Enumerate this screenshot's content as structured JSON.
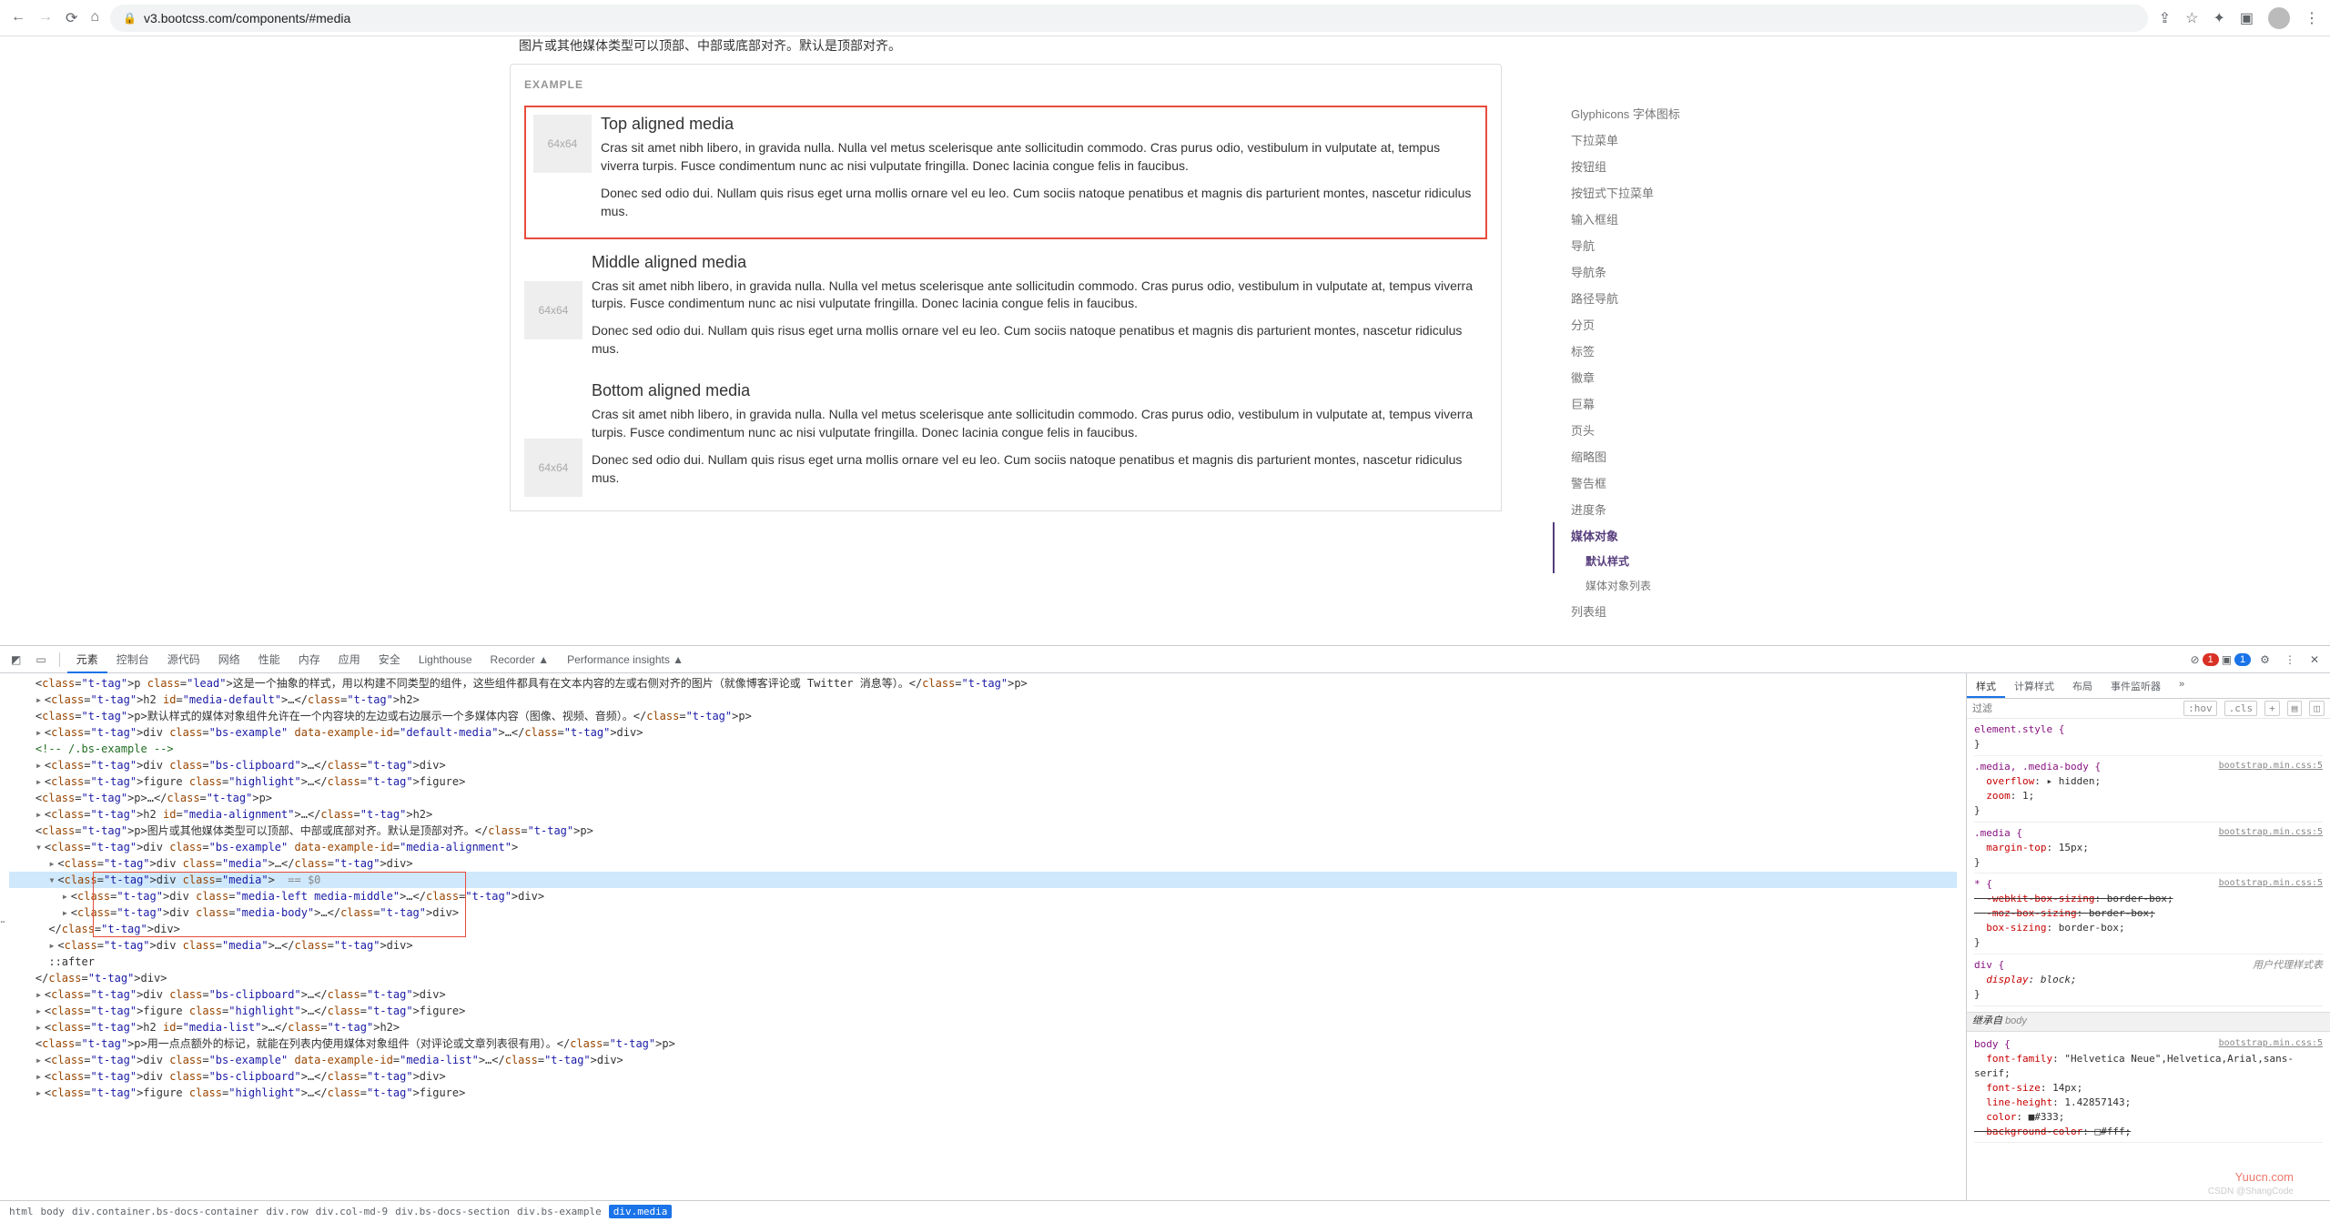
{
  "browser": {
    "url": "v3.bootcss.com/components/#media",
    "icons": {
      "back": "←",
      "forward": "→",
      "reload": "⟳",
      "home": "⌂",
      "lock": "🔒",
      "share": "⇪",
      "star": "☆",
      "ext": "✦",
      "profile": "▣",
      "menu": "⋮"
    }
  },
  "page": {
    "truncated_text": "图片或其他媒体类型可以顶部、中部或底部对齐。默认是顶部对齐。",
    "example_label": "EXAMPLE",
    "placeholder": "64x64",
    "para1": "Cras sit amet nibh libero, in gravida nulla. Nulla vel metus scelerisque ante sollicitudin commodo. Cras purus odio, vestibulum in vulputate at, tempus viverra turpis. Fusce condimentum nunc ac nisi vulputate fringilla. Donec lacinia congue felis in faucibus.",
    "para2": "Donec sed odio dui. Nullam quis risus eget urna mollis ornare vel eu leo. Cum sociis natoque penatibus et magnis dis parturient montes, nascetur ridiculus mus.",
    "headings": {
      "top": "Top aligned media",
      "middle": "Middle aligned media",
      "bottom": "Bottom aligned media"
    }
  },
  "sidebar": {
    "items": [
      {
        "label": "Glyphicons 字体图标"
      },
      {
        "label": "下拉菜单"
      },
      {
        "label": "按钮组"
      },
      {
        "label": "按钮式下拉菜单"
      },
      {
        "label": "输入框组"
      },
      {
        "label": "导航"
      },
      {
        "label": "导航条"
      },
      {
        "label": "路径导航"
      },
      {
        "label": "分页"
      },
      {
        "label": "标签"
      },
      {
        "label": "徽章"
      },
      {
        "label": "巨幕"
      },
      {
        "label": "页头"
      },
      {
        "label": "缩略图"
      },
      {
        "label": "警告框"
      },
      {
        "label": "进度条"
      },
      {
        "label": "媒体对象",
        "active": true,
        "sub": [
          {
            "label": "默认样式",
            "active": true
          },
          {
            "label": "媒体对象列表"
          }
        ]
      },
      {
        "label": "列表组"
      }
    ]
  },
  "devtools": {
    "tabs": [
      "元素",
      "控制台",
      "源代码",
      "网络",
      "性能",
      "内存",
      "应用",
      "安全",
      "Lighthouse",
      "Recorder ▲",
      "Performance insights ▲"
    ],
    "active_tab": "元素",
    "err_count": "1",
    "info_count": "1",
    "settings": "⚙",
    "more": "⋮",
    "close": "✕",
    "lines": [
      {
        "i": 2,
        "h": "<p class=\"lead\">这是一个抽象的样式，用以构建不同类型的组件，这些组件都具有在文本内容的左或右侧对齐的图片（就像博客评论或 Twitter 消息等）。</p>"
      },
      {
        "i": 2,
        "a": "▸",
        "h": "<h2 id=\"media-default\">…</h2>"
      },
      {
        "i": 2,
        "h": "<p>默认样式的媒体对象组件允许在一个内容块的左边或右边展示一个多媒体内容（图像、视频、音频）。</p>"
      },
      {
        "i": 2,
        "a": "▸",
        "h": "<div class=\"bs-example\" data-example-id=\"default-media\">…</div>"
      },
      {
        "i": 2,
        "cmt": "<!-- /.bs-example -->"
      },
      {
        "i": 2,
        "a": "▸",
        "h": "<div class=\"bs-clipboard\">…</div>"
      },
      {
        "i": 2,
        "a": "▸",
        "h": "<figure class=\"highlight\">…</figure>"
      },
      {
        "i": 2,
        "h": "<p>…</p>"
      },
      {
        "i": 2,
        "a": "▸",
        "h": "<h2 id=\"media-alignment\">…</h2>"
      },
      {
        "i": 2,
        "h": "<p>图片或其他媒体类型可以顶部、中部或底部对齐。默认是顶部对齐。</p>"
      },
      {
        "i": 2,
        "a": "▾",
        "h": "<div class=\"bs-example\" data-example-id=\"media-alignment\">"
      },
      {
        "i": 3,
        "a": "▸",
        "h": "<div class=\"media\">…</div>"
      },
      {
        "i": 3,
        "a": "▾",
        "h": "<div class=\"media\"> == $0",
        "hl": true
      },
      {
        "i": 4,
        "a": "▸",
        "h": "<div class=\"media-left media-middle\">…</div>"
      },
      {
        "i": 4,
        "a": "▸",
        "h": "<div class=\"media-body\">…</div>"
      },
      {
        "i": 3,
        "h": "</div>"
      },
      {
        "i": 3,
        "a": "▸",
        "h": "<div class=\"media\">…</div>"
      },
      {
        "i": 3,
        "h": "::after"
      },
      {
        "i": 2,
        "h": "</div>"
      },
      {
        "i": 2,
        "a": "▸",
        "h": "<div class=\"bs-clipboard\">…</div>"
      },
      {
        "i": 2,
        "a": "▸",
        "h": "<figure class=\"highlight\">…</figure>"
      },
      {
        "i": 2,
        "a": "▸",
        "h": "<h2 id=\"media-list\">…</h2>"
      },
      {
        "i": 2,
        "h": "<p>用一点点额外的标记，就能在列表内使用媒体对象组件（对评论或文章列表很有用）。</p>"
      },
      {
        "i": 2,
        "a": "▸",
        "h": "<div class=\"bs-example\" data-example-id=\"media-list\">…</div>"
      },
      {
        "i": 2,
        "a": "▸",
        "h": "<div class=\"bs-clipboard\">…</div>"
      },
      {
        "i": 2,
        "a": "▸",
        "h": "<figure class=\"highlight\">…</figure>"
      }
    ],
    "crumbs": [
      "html",
      "body",
      "div.container.bs-docs-container",
      "div.row",
      "div.col-md-9",
      "div.bs-docs-section",
      "div.bs-example",
      "div.media"
    ],
    "styles": {
      "tabs": [
        "样式",
        "计算样式",
        "布局",
        "事件监听器",
        "»"
      ],
      "filter_ph": "过滤",
      "hov": ":hov",
      "cls": ".cls",
      "rules": [
        {
          "sel": "element.style {",
          "props": [],
          "end": "}"
        },
        {
          "sel": ".media, .media-body {",
          "src": "bootstrap.min.css:5",
          "props": [
            {
              "p": "overflow",
              "v": "▸ hidden;"
            },
            {
              "p": "zoom",
              "v": "1;"
            }
          ],
          "end": "}"
        },
        {
          "sel": ".media {",
          "src": "bootstrap.min.css:5",
          "props": [
            {
              "p": "margin-top",
              "v": "15px;"
            }
          ],
          "end": "}"
        },
        {
          "sel": "* {",
          "src": "bootstrap.min.css:5",
          "props": [
            {
              "p": "-webkit-box-sizing",
              "v": "border-box;",
              "strike": true
            },
            {
              "p": "-moz-box-sizing",
              "v": "border-box;",
              "strike": true
            },
            {
              "p": "box-sizing",
              "v": "border-box;"
            }
          ],
          "end": "}"
        },
        {
          "sel": "div {",
          "ua": "用户代理样式表",
          "props": [
            {
              "p": "display",
              "v": "block;",
              "italic": true
            }
          ],
          "end": "}"
        }
      ],
      "inherited": "继承自 body",
      "body_rule": {
        "sel": "body {",
        "src": "bootstrap.min.css:5",
        "props": [
          {
            "p": "font-family",
            "v": "\"Helvetica Neue\",Helvetica,Arial,sans-serif;"
          },
          {
            "p": "font-size",
            "v": "14px;"
          },
          {
            "p": "line-height",
            "v": "1.42857143;"
          },
          {
            "p": "color",
            "v": "■#333;"
          },
          {
            "p": "background-color",
            "v": "□#fff;",
            "strike": true
          }
        ]
      }
    }
  },
  "watermark": "Yuucn.com",
  "sub_watermark": "CSDN @ShangCode"
}
